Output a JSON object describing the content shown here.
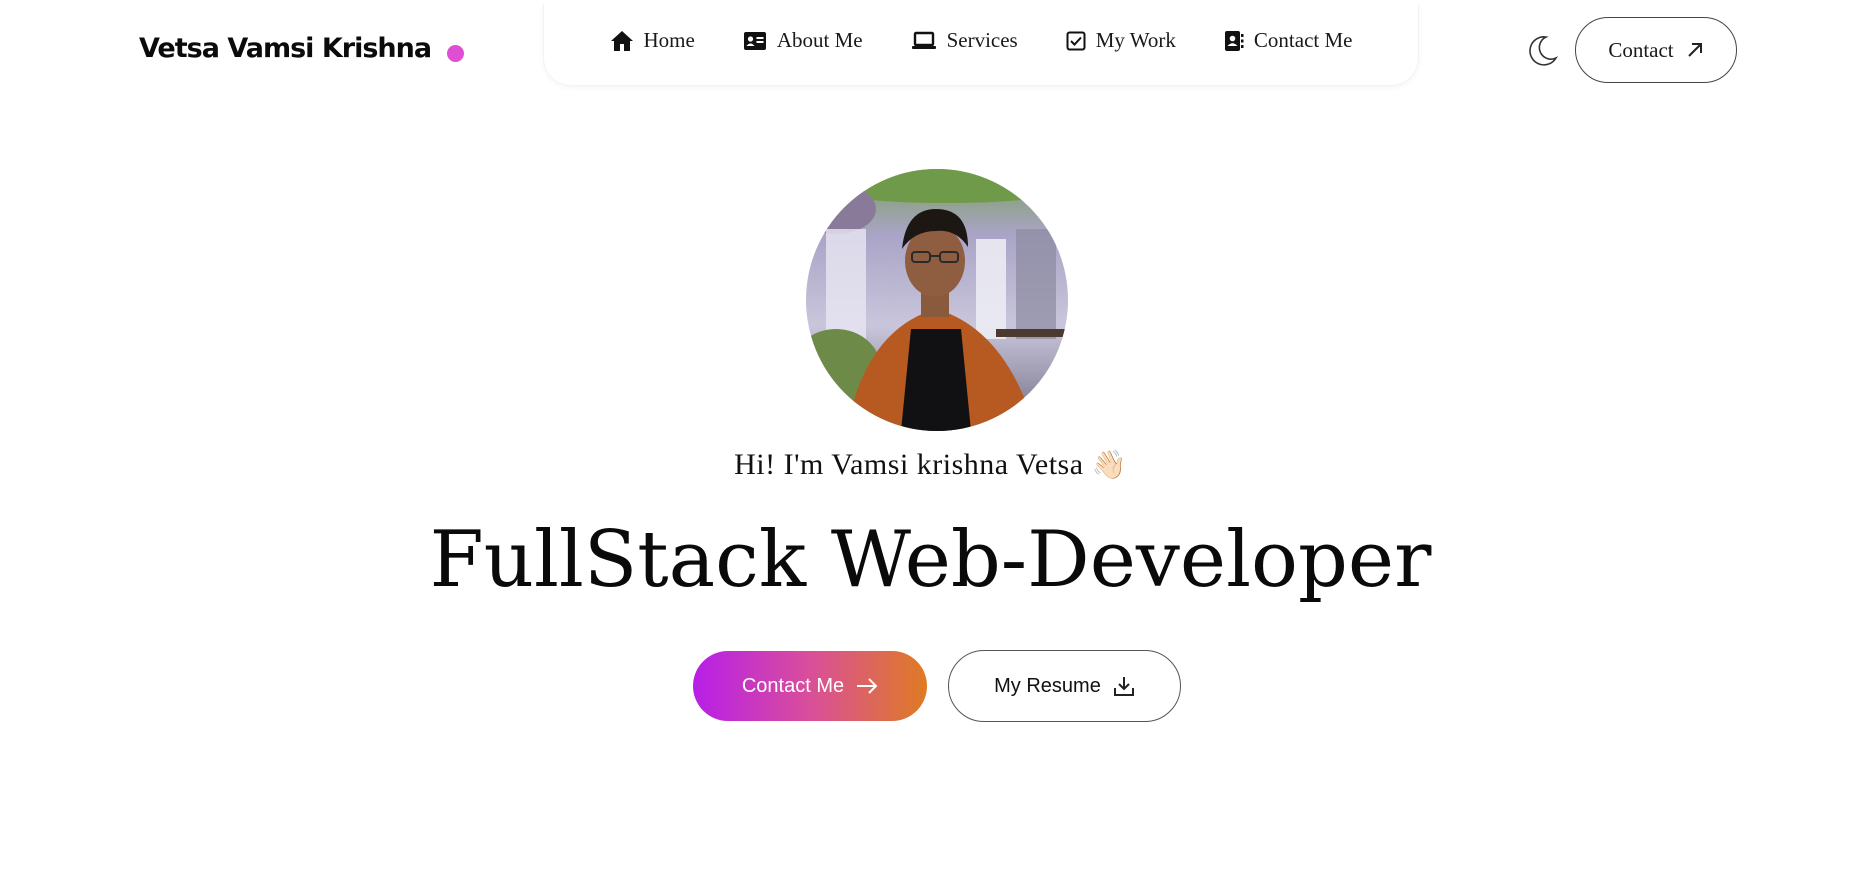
{
  "header": {
    "logo_text": "Vetsa Vamsi Krishna",
    "logo_dot_color": "#e04fd3",
    "contact_button_label": "Contact"
  },
  "nav": {
    "items": [
      {
        "label": "Home",
        "icon": "home-icon"
      },
      {
        "label": "About Me",
        "icon": "id-card-icon"
      },
      {
        "label": "Services",
        "icon": "laptop-icon"
      },
      {
        "label": "My Work",
        "icon": "checkbox-icon"
      },
      {
        "label": "Contact Me",
        "icon": "address-book-icon"
      }
    ]
  },
  "theme_toggle_icon": "moon-icon",
  "hero": {
    "greeting": "Hi! I'm Vamsi krishna Vetsa",
    "wave_emoji": "👋🏻",
    "headline": "FullStack Web-Developer",
    "contact_button_label": "Contact Me",
    "resume_button_label": "My Resume",
    "gradient_colors": [
      "#b71ee8",
      "#df7b22"
    ]
  }
}
